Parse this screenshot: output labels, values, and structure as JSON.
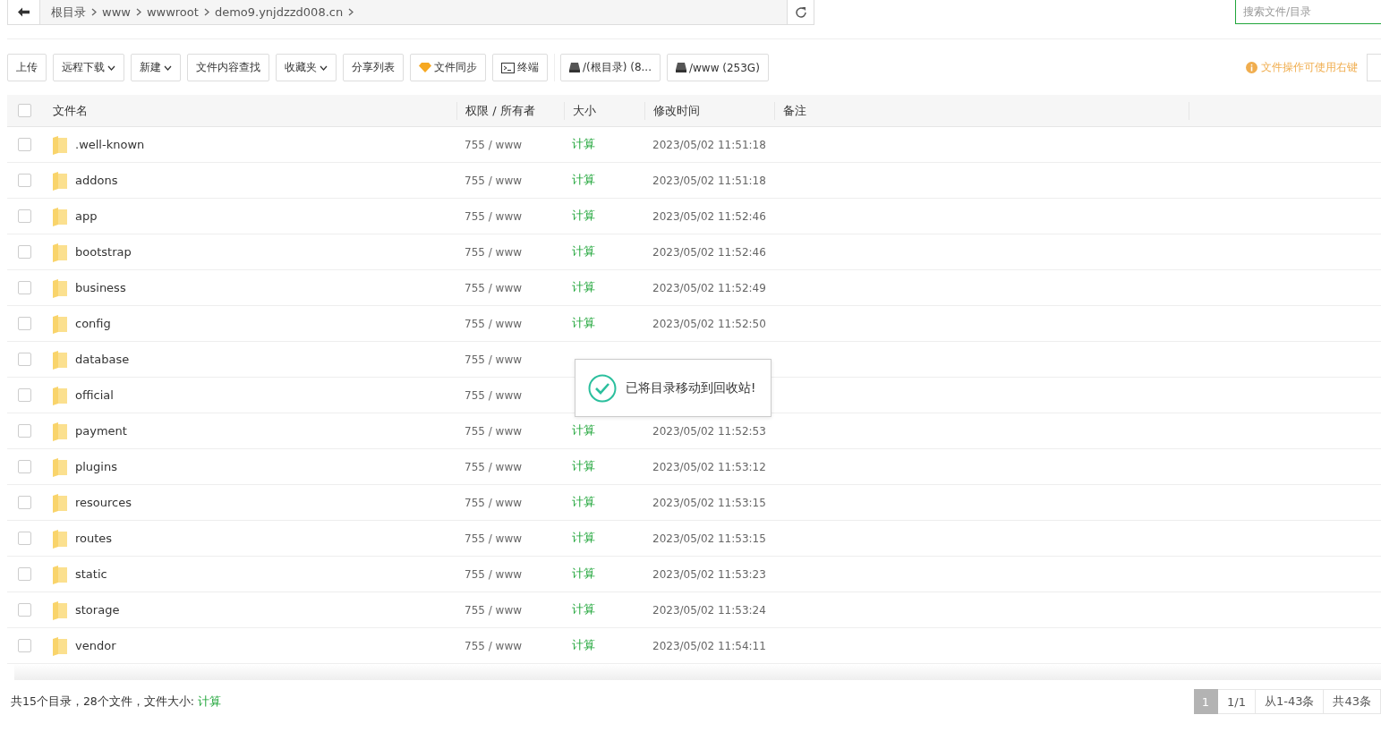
{
  "breadcrumb": {
    "items": [
      "根目录",
      "www",
      "wwwroot",
      "demo9.ynjdzzd008.cn"
    ]
  },
  "search": {
    "placeholder": "搜索文件/目录"
  },
  "toolbar": [
    {
      "label": "上传",
      "kind": "plain"
    },
    {
      "label": "远程下载",
      "kind": "dropdown"
    },
    {
      "label": "新建",
      "kind": "dropdown"
    },
    {
      "label": "文件内容查找",
      "kind": "plain"
    },
    {
      "label": "收藏夹",
      "kind": "dropdown"
    },
    {
      "label": "分享列表",
      "kind": "plain"
    },
    {
      "label": "文件同步",
      "kind": "sync"
    },
    {
      "label": "终端",
      "kind": "terminal"
    },
    {
      "label": "/(根目录) (8...",
      "kind": "disk"
    },
    {
      "label": "/www (253G)",
      "kind": "disk"
    }
  ],
  "hint": "文件操作可使用右键",
  "table": {
    "select_all": {
      "checked": false
    },
    "columns": [
      "文件名",
      "权限 / 所有者",
      "大小",
      "修改时间",
      "备注"
    ],
    "rows": [
      {
        "name": ".well-known",
        "perm": "755 / www",
        "size": "计算",
        "time": "2023/05/02 11:51:18",
        "checked": false
      },
      {
        "name": "addons",
        "perm": "755 / www",
        "size": "计算",
        "time": "2023/05/02 11:51:18",
        "checked": false
      },
      {
        "name": "app",
        "perm": "755 / www",
        "size": "计算",
        "time": "2023/05/02 11:52:46",
        "checked": false
      },
      {
        "name": "bootstrap",
        "perm": "755 / www",
        "size": "计算",
        "time": "2023/05/02 11:52:46",
        "checked": false
      },
      {
        "name": "business",
        "perm": "755 / www",
        "size": "计算",
        "time": "2023/05/02 11:52:49",
        "checked": false
      },
      {
        "name": "config",
        "perm": "755 / www",
        "size": "计算",
        "time": "2023/05/02 11:52:50",
        "checked": false
      },
      {
        "name": "database",
        "perm": "755 / www",
        "checked": false
      },
      {
        "name": "official",
        "perm": "755 / www",
        "checked": false
      },
      {
        "name": "payment",
        "perm": "755 / www",
        "size": "计算",
        "time": "2023/05/02 11:52:53",
        "checked": false
      },
      {
        "name": "plugins",
        "perm": "755 / www",
        "size": "计算",
        "time": "2023/05/02 11:53:12",
        "checked": false
      },
      {
        "name": "resources",
        "perm": "755 / www",
        "size": "计算",
        "time": "2023/05/02 11:53:15",
        "checked": false
      },
      {
        "name": "routes",
        "perm": "755 / www",
        "size": "计算",
        "time": "2023/05/02 11:53:15",
        "checked": false
      },
      {
        "name": "static",
        "perm": "755 / www",
        "size": "计算",
        "time": "2023/05/02 11:53:23",
        "checked": false
      },
      {
        "name": "storage",
        "perm": "755 / www",
        "size": "计算",
        "time": "2023/05/02 11:53:24",
        "checked": false
      },
      {
        "name": "vendor",
        "perm": "755 / www",
        "size": "计算",
        "time": "2023/05/02 11:54:11",
        "checked": false
      }
    ]
  },
  "toast": {
    "message": "已将目录移动到回收站!"
  },
  "footer": {
    "summary": "共15个目录，28个文件，文件大小:",
    "size_link": "计算"
  },
  "pagination": [
    {
      "label": "1",
      "selected": true
    },
    {
      "label": "1/1",
      "selected": false
    },
    {
      "label": "从1-43条",
      "selected": false
    },
    {
      "label": "共43条",
      "selected": false
    }
  ]
}
